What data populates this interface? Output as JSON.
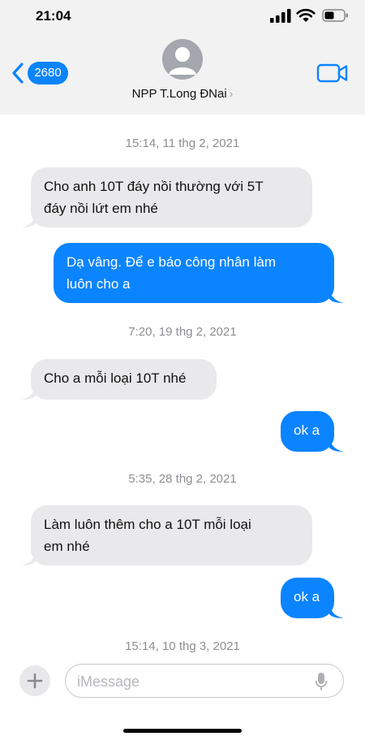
{
  "status_bar": {
    "time": "21:04",
    "icons": [
      "cellular-signal-icon",
      "wifi-icon",
      "battery-icon"
    ]
  },
  "header": {
    "back_count": "2680",
    "contact_name": "NPP T.Long ĐNai",
    "contact_chevron": "›",
    "icons": [
      "back-chevron-icon",
      "contact-avatar-icon",
      "video-camera-icon"
    ]
  },
  "colors": {
    "accent": "#0b84ff",
    "incoming_bubble": "#e9e9eb",
    "header_bg": "#f2f2f2",
    "timestamp": "#8e8e93"
  },
  "thread": {
    "timestamps": [
      "15:14, 11 thg 2, 2021",
      "7:20, 19 thg 2, 2021",
      "5:35, 28 thg 2, 2021",
      "15:14, 10 thg 3, 2021"
    ],
    "messages": [
      {
        "direction": "incoming",
        "lines": [
          "Cho anh 10T đáy nồi thường với 5T",
          "đáy nồi lứt em nhé"
        ]
      },
      {
        "direction": "outgoing",
        "lines": [
          "Dạ vâng. Để e báo công nhân làm",
          "luôn cho a"
        ]
      },
      {
        "direction": "incoming",
        "lines": [
          "Cho a mỗi loại 10T nhé"
        ]
      },
      {
        "direction": "outgoing",
        "lines": [
          "ok a"
        ]
      },
      {
        "direction": "incoming",
        "lines": [
          "Làm luôn thêm cho a 10T mỗi loại",
          "em nhé"
        ]
      },
      {
        "direction": "outgoing",
        "lines": [
          "ok a"
        ]
      }
    ]
  },
  "compose": {
    "placeholder": "iMessage",
    "value": "",
    "icons": [
      "plus-icon",
      "microphone-icon"
    ]
  }
}
